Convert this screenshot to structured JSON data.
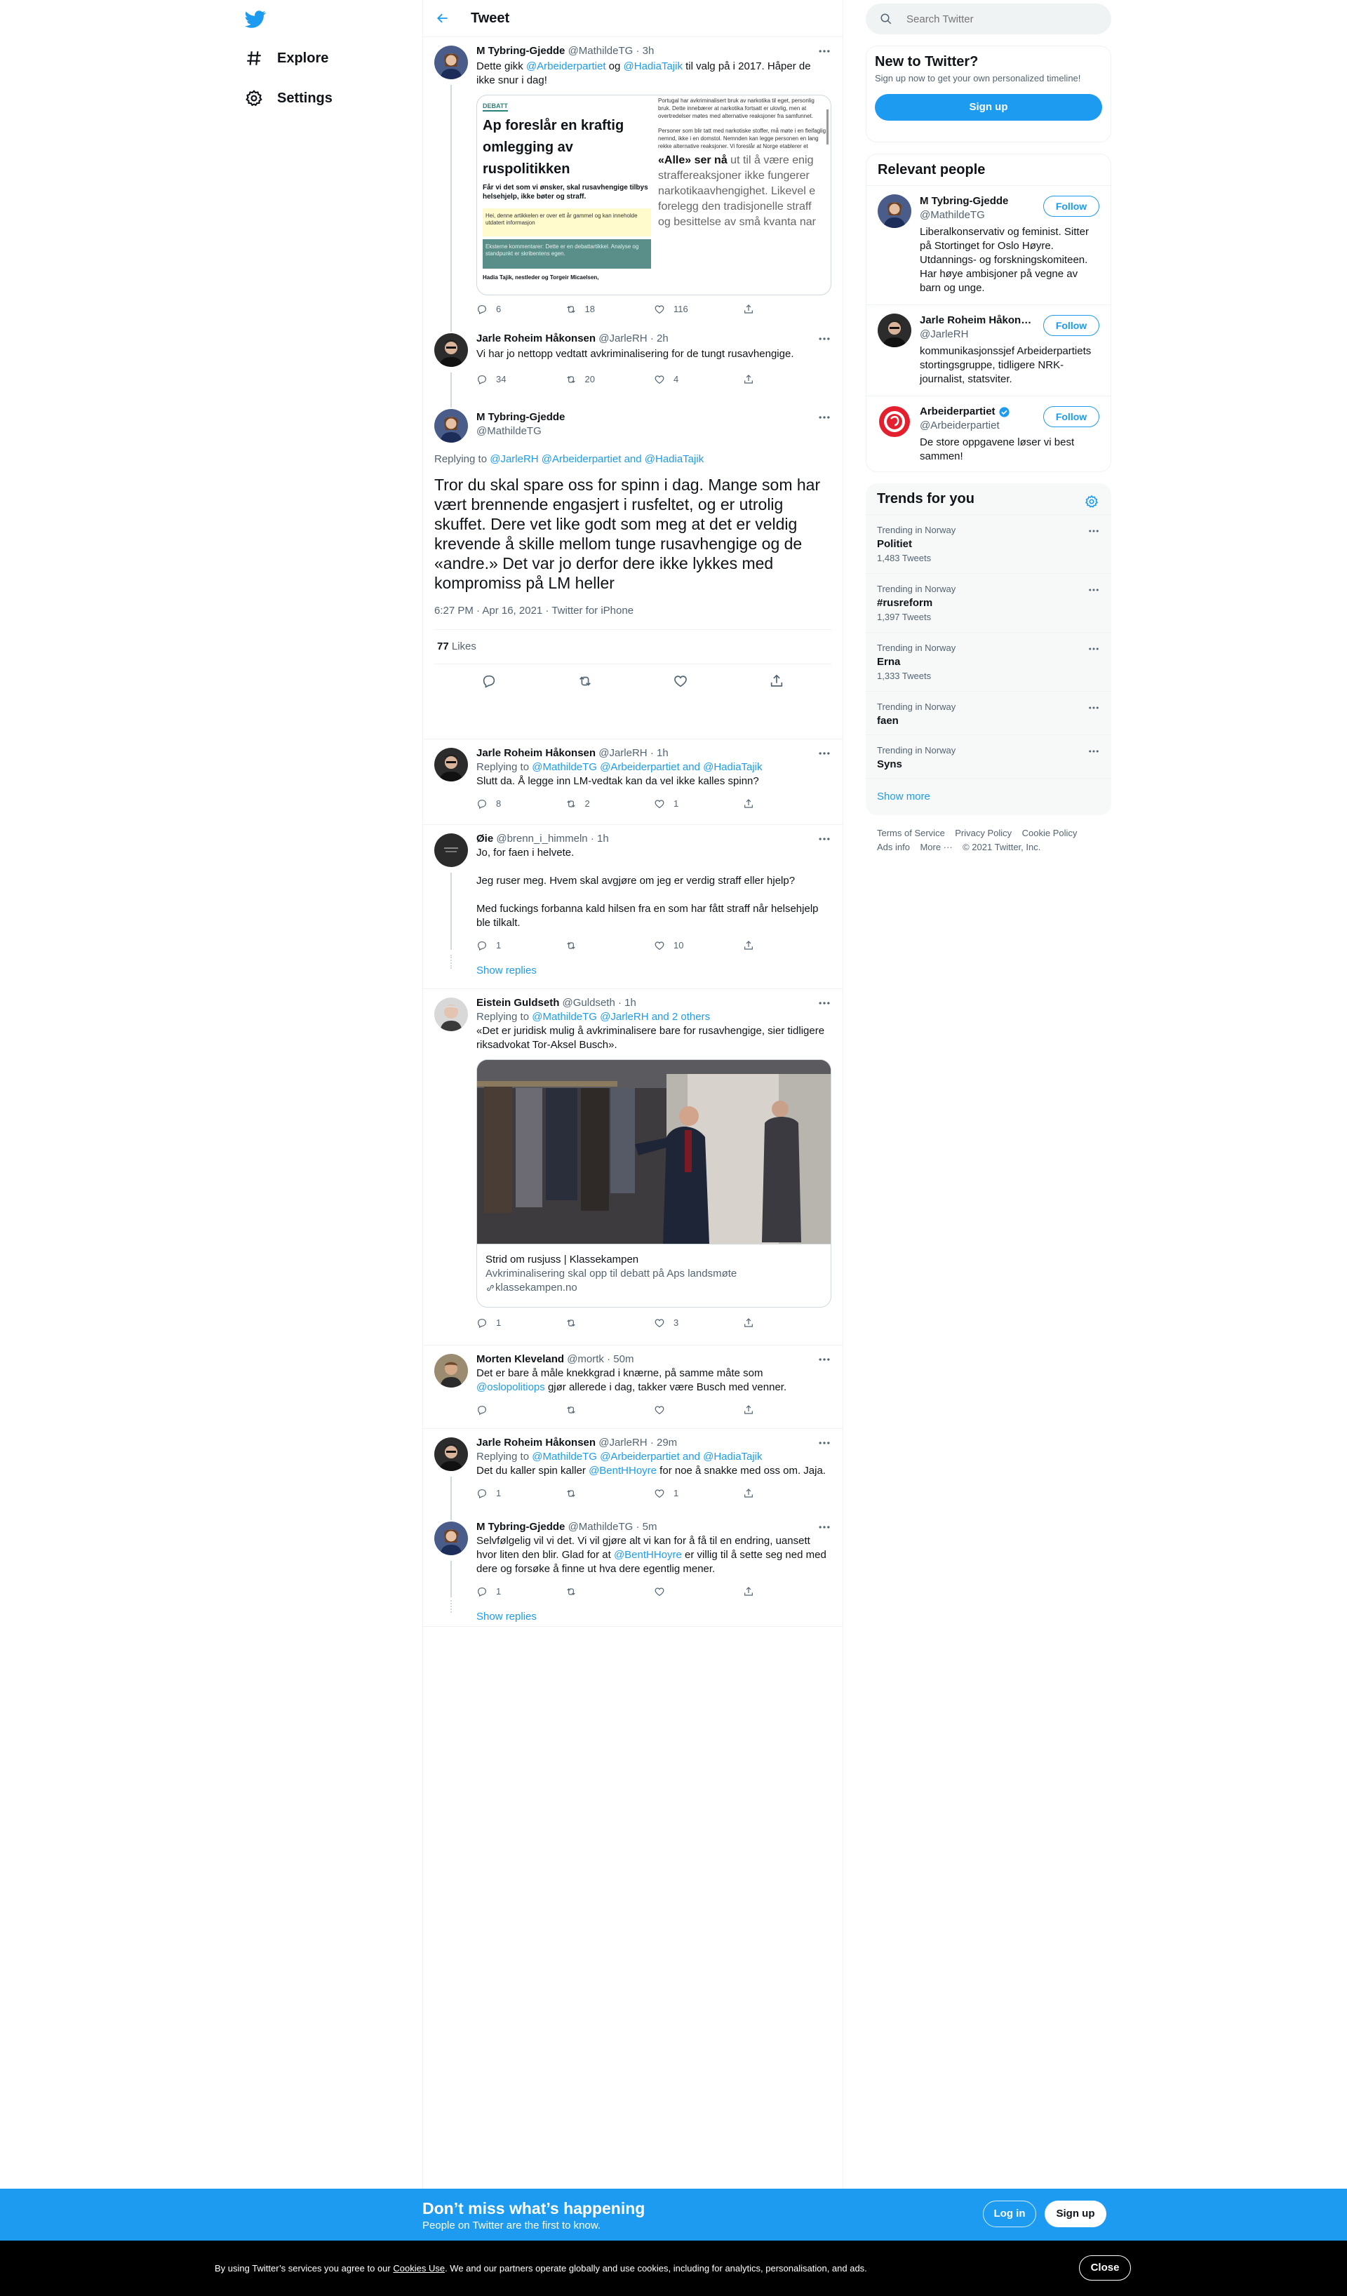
{
  "nav": {
    "explore": "Explore",
    "settings": "Settings"
  },
  "header": {
    "title": "Tweet"
  },
  "tweets": [
    {
      "name": "M Tybring-Gjedde",
      "handle": "@MathildeTG",
      "time": "· 3h",
      "text_a": "Dette gikk ",
      "mention_1": "@Arbeiderpartiet",
      "text_b": " og ",
      "mention_2": "@HadiaTajik",
      "text_c": " til valg på i 2017. Håper de ikke snur i dag!",
      "replies": "6",
      "retweets": "18",
      "likes": "116"
    },
    {
      "name": "Jarle Roheim Håkonsen",
      "handle": "@JarleRH",
      "time": "· 2h",
      "text": "Vi har jo nettopp vedtatt avkriminalisering for de tungt rusavhengige.",
      "replies": "34",
      "retweets": "20",
      "likes": "4"
    }
  ],
  "article_image": {
    "tag": "DEBATT",
    "headline": "Ap foreslår en kraftig omlegging av ruspolitikken",
    "lead": "Får vi det som vi ønsker, skal rusavhengige tilbys helsehjelp, ikke bøter og straff.",
    "note": "Hei, denne artikkelen er over ett år gammel og kan inneholde utdatert informasjon",
    "notebold": "over ett år gammel",
    "comments": "Eksterne kommentarer: Dette er en debattartikkel. Analyse og standpunkt er skribentens egen.",
    "byline": "Hadia Tajik, nestleder og  Torgeir Micaelsen,",
    "col_p1": "Portugal har avkriminalisert bruk av narkotika til eget, personlig bruk. Dette innebærer at narkotika fortsatt er ulovlig, men at overtredelser møtes med alternative reaksjoner fra samfunnet.",
    "col_p2": "Personer som blir tatt med narkotiske stoffer, må møte i en fleifaglig nemnd, ikke i en domstol. Nemnden kan legge personen en lang rekke alternative reaksjoner. Vi foreslår at Norge etablerer et",
    "quote_bold": "«Alle» ser nå",
    "quote_rest": " ut til å være enig straffereaksjoner ikke fungerer narkotikaavhengighet. Likevel e forelegg den tradisjonelle straff og besittelse av små kvanta nar"
  },
  "main_tweet": {
    "name": "M Tybring-Gjedde",
    "handle": "@MathildeTG",
    "replying_label": "Replying to ",
    "replying_to": "@JarleRH @Arbeiderpartiet and @HadiaTajik",
    "text": "Tror du skal spare oss for spinn i dag. Mange som har vært brennende engasjert i rusfeltet, og er utrolig skuffet. Dere vet like godt som meg at det er veldig krevende å skille mellom tunge rusavhengige og de «andre.» Det var jo derfor dere ikke lykkes med kompromiss på LM heller",
    "meta": "6:27 PM · Apr 16, 2021 · Twitter for iPhone",
    "likes_count": "77",
    "likes_label": " Likes"
  },
  "replies": [
    {
      "name": "Jarle Roheim Håkonsen",
      "handle": "@JarleRH",
      "time": "· 1h",
      "replying_label": "Replying to ",
      "replying_to": "@MathildeTG @Arbeiderpartiet and @HadiaTajik",
      "text": "Slutt da. Å legge inn LM-vedtak kan da vel ikke kalles spinn?",
      "replies": "8",
      "retweets": "2",
      "likes": "1"
    },
    {
      "name": "Øie",
      "handle": "@brenn_i_himmeln",
      "time": "· 1h",
      "line1": "Jo, for faen i helvete.",
      "line2": "Jeg ruser meg. Hvem skal avgjøre om jeg er verdig straff eller hjelp?",
      "line3": "Med fuckings forbanna kald hilsen fra en som har fått straff når helsehjelp ble tilkalt.",
      "replies": "1",
      "retweets": "",
      "likes": "10",
      "show_replies": "Show replies"
    },
    {
      "name": "Eistein Guldseth",
      "handle": "@Guldseth",
      "time": "· 1h",
      "replying_label": "Replying to ",
      "replying_to": "@MathildeTG @JarleRH and 2 others",
      "text": "«Det er juridisk mulig å avkriminalisere bare for rusavhengige, sier tidligere riksadvokat Tor-Aksel Busch».",
      "card_title": "Strid om rusjuss | Klassekampen",
      "card_desc": "Avkriminalisering skal opp til debatt på Aps landsmøte",
      "card_domain": "klassekampen.no",
      "replies": "1",
      "retweets": "",
      "likes": "3"
    },
    {
      "name": "Morten Kleveland",
      "handle": "@mortk",
      "time": "· 50m",
      "text_a": "Det er bare å måle knekkgrad i knærne, på samme måte som ",
      "mention": "@oslopolitiops",
      "text_b": " gjør allerede i dag, takker være Busch med venner."
    },
    {
      "name": "Jarle Roheim Håkonsen",
      "handle": "@JarleRH",
      "time": "· 29m",
      "replying_label": "Replying to ",
      "replying_to": "@MathildeTG @Arbeiderpartiet and @HadiaTajik",
      "text_a": "Det du kaller spin kaller ",
      "mention": "@BentHHoyre",
      "text_b": " for noe å snakke med oss om. Jaja.",
      "replies": "1",
      "retweets": "",
      "likes": "1"
    },
    {
      "name": "M Tybring-Gjedde",
      "handle": "@MathildeTG",
      "time": "· 5m",
      "text_a": "Selvfølgelig vil vi det. Vi vil gjøre alt vi kan for å få til en endring, uansett hvor liten den blir. Glad for at ",
      "mention": "@BentHHoyre",
      "text_b": " er villig til å sette seg ned med dere og forsøke å finne ut hva dere egentlig mener.",
      "replies": "1",
      "retweets": "",
      "likes": "",
      "show_replies": "Show replies"
    }
  ],
  "search": {
    "placeholder": "Search Twitter"
  },
  "new_to_twitter": {
    "title": "New to Twitter?",
    "subtitle": "Sign up now to get your own personalized timeline!",
    "signup": "Sign up"
  },
  "relevant": {
    "title": "Relevant people",
    "follow_label": "Follow",
    "people": [
      {
        "name": "M Tybring-Gjedde",
        "handle": "@MathildeTG",
        "bio": "Liberalkonservativ og feminist. Sitter på Stortinget for Oslo Høyre. Utdannings- og forskningskomiteen. Har høye ambisjoner på vegne av barn og unge."
      },
      {
        "name": "Jarle Roheim Håkon…",
        "handle": "@JarleRH",
        "bio": "kommunikasjonssjef Arbeiderpartiets stortingsgruppe, tidligere NRK-journalist, statsviter."
      },
      {
        "name": "Arbeiderpartiet",
        "handle": "@Arbeiderpartiet",
        "bio": "De store oppgavene løser vi best sammen!"
      }
    ]
  },
  "trends": {
    "title": "Trends for you",
    "items": [
      {
        "context": "Trending in Norway",
        "name": "Politiet",
        "count": "1,483 Tweets"
      },
      {
        "context": "Trending in Norway",
        "name": "#rusreform",
        "count": "1,397 Tweets"
      },
      {
        "context": "Trending in Norway",
        "name": "Erna",
        "count": "1,333 Tweets"
      },
      {
        "context": "Trending in Norway",
        "name": "faen",
        "count": ""
      },
      {
        "context": "Trending in Norway",
        "name": "Syns",
        "count": ""
      }
    ],
    "show_more": "Show more"
  },
  "footer": {
    "terms": "Terms of Service",
    "privacy": "Privacy Policy",
    "cookie": "Cookie Policy",
    "ads": "Ads info",
    "more": "More ···",
    "copyright": "© 2021 Twitter, Inc."
  },
  "banner": {
    "title": "Don’t miss what’s happening",
    "subtitle": "People on Twitter are the first to know.",
    "login": "Log in",
    "signup": "Sign up"
  },
  "cookie": {
    "text_a": "By using Twitter’s services you agree to our ",
    "link": "Cookies Use",
    "text_b": ". We and our partners operate globally and use cookies, including for analytics, personalisation, and ads.",
    "close": "Close"
  },
  "colors": {
    "accent": "#1d9bf0",
    "text": "#0f1419",
    "muted": "#536471",
    "ap_red": "#e4202e"
  }
}
